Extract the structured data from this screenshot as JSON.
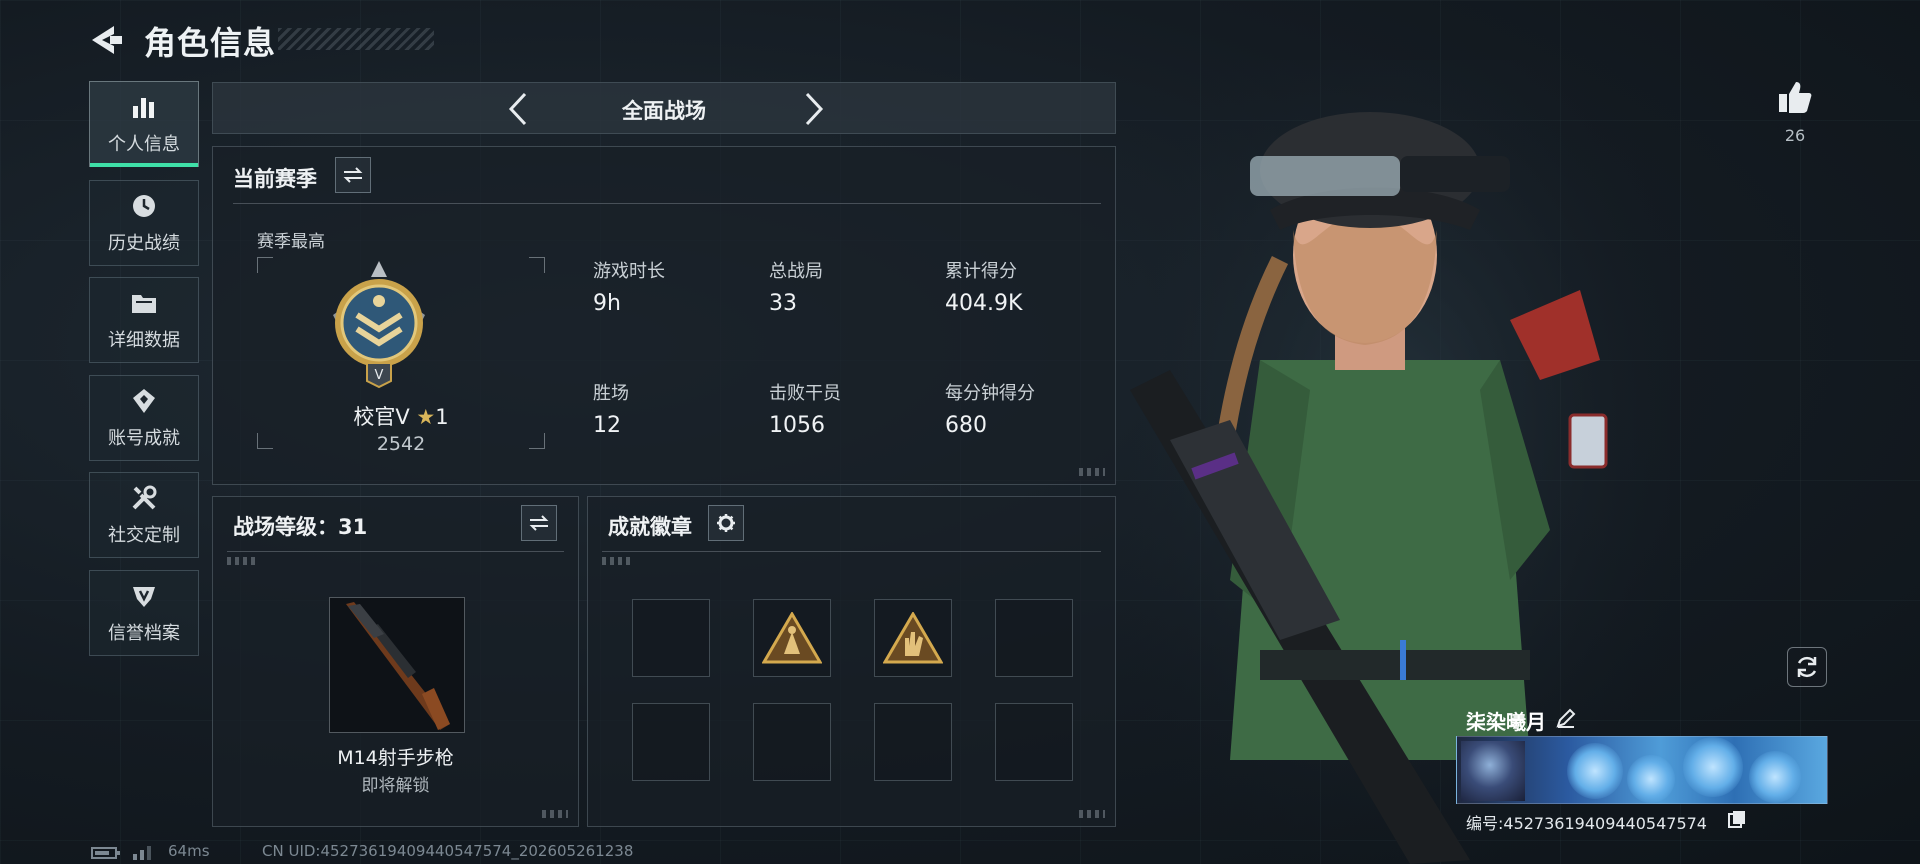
{
  "header": {
    "title": "角色信息",
    "back_icon": "back-arrow-icon"
  },
  "sidebar": {
    "items": [
      {
        "label": "个人信息",
        "icon": "bar-chart-icon",
        "active": true
      },
      {
        "label": "历史战绩",
        "icon": "clock-icon",
        "active": false
      },
      {
        "label": "详细数据",
        "icon": "folder-icon",
        "active": false
      },
      {
        "label": "账号成就",
        "icon": "achievement-icon",
        "active": false
      },
      {
        "label": "社交定制",
        "icon": "tools-icon",
        "active": false
      },
      {
        "label": "信誉档案",
        "icon": "shield-icon",
        "active": false
      }
    ]
  },
  "mode_selector": {
    "label": "全面战场",
    "prev_icon": "chevron-left-icon",
    "next_icon": "chevron-right-icon"
  },
  "season": {
    "title": "当前赛季",
    "switch_icon": "swap-icon",
    "best_label": "赛季最高",
    "rank_name": "校官V",
    "rank_stars": "1",
    "rank_score": "2542",
    "stats": [
      {
        "label": "游戏时长",
        "value": "9h"
      },
      {
        "label": "总战局",
        "value": "33"
      },
      {
        "label": "累计得分",
        "value": "404.9K"
      },
      {
        "label": "胜场",
        "value": "12"
      },
      {
        "label": "击败干员",
        "value": "1056"
      },
      {
        "label": "每分钟得分",
        "value": "680"
      }
    ]
  },
  "battlefield_level": {
    "title": "战场等级：31",
    "switch_icon": "swap-icon",
    "weapon_name": "M14射手步枪",
    "weapon_status": "即将解锁"
  },
  "achievements": {
    "title": "成就徽章",
    "settings_icon": "gear-icon",
    "slots": [
      {
        "filled": false
      },
      {
        "filled": true,
        "icon": "badge-triangle-icon"
      },
      {
        "filled": true,
        "icon": "badge-hand-icon"
      },
      {
        "filled": false
      },
      {
        "filled": false
      },
      {
        "filled": false
      },
      {
        "filled": false
      },
      {
        "filled": false
      }
    ]
  },
  "profile": {
    "likes": "26",
    "like_icon": "thumbs-up-icon",
    "refresh_icon": "refresh-icon",
    "name": "柒染曦月",
    "edit_icon": "pencil-icon",
    "id_text": "编号:4527361940944054757​4",
    "copy_icon": "copy-icon"
  },
  "status_bar": {
    "ping": "64ms",
    "uid": "CN UID:4527361940944054757​4_202605261238"
  },
  "colors": {
    "accent": "#3fe0a8",
    "gold": "#c9a24a",
    "uniform_green": "#3e6b45"
  }
}
